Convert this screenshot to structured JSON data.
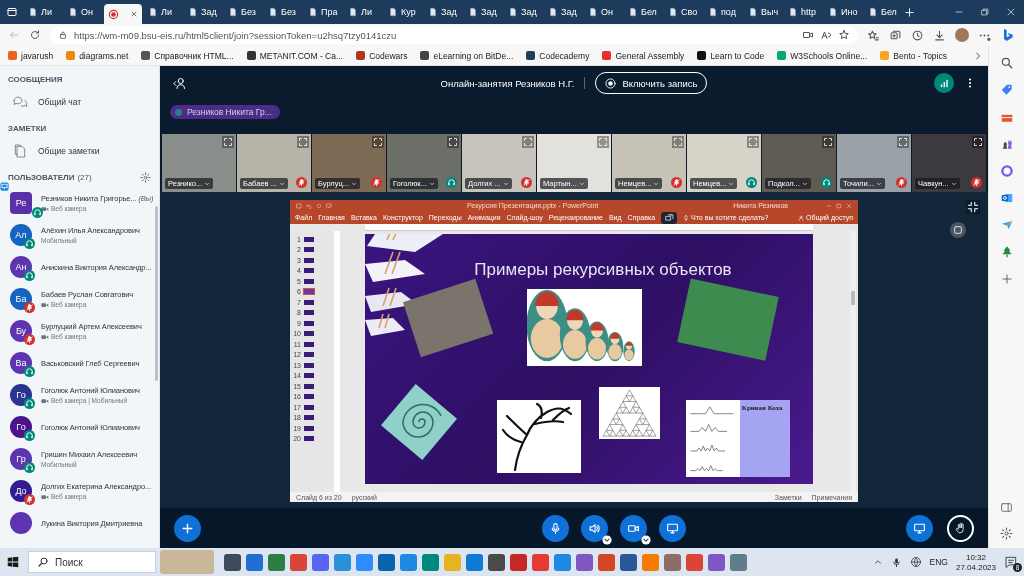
{
  "browser": {
    "tabs": [
      {
        "label": "Ли",
        "kind": "page",
        "selected": false
      },
      {
        "label": "Он",
        "kind": "page",
        "selected": false
      },
      {
        "kind": "record",
        "selected": true
      },
      {
        "label": "Ли",
        "kind": "page",
        "selected": false
      },
      {
        "label": "Зад",
        "kind": "page",
        "selected": false
      },
      {
        "label": "Без",
        "kind": "page",
        "selected": false
      },
      {
        "label": "Без",
        "kind": "page",
        "selected": false
      },
      {
        "label": "Пра",
        "kind": "page",
        "selected": false
      },
      {
        "label": "Ли",
        "kind": "page",
        "selected": false
      },
      {
        "label": "Кур",
        "kind": "page",
        "selected": false
      },
      {
        "label": "Зад",
        "kind": "page",
        "selected": false
      },
      {
        "label": "Зад",
        "kind": "page",
        "selected": false
      },
      {
        "label": "Зад",
        "kind": "page",
        "selected": false
      },
      {
        "label": "Зад",
        "kind": "page",
        "selected": false
      },
      {
        "label": "Он",
        "kind": "page",
        "selected": false
      },
      {
        "label": "Бел",
        "kind": "page",
        "selected": false
      },
      {
        "label": "Сво",
        "kind": "page",
        "selected": false
      },
      {
        "label": "под",
        "kind": "page",
        "selected": false
      },
      {
        "label": "Выч",
        "kind": "page",
        "selected": false
      },
      {
        "label": "http",
        "kind": "page",
        "selected": false
      },
      {
        "label": "Ино",
        "kind": "page",
        "selected": false
      },
      {
        "label": "Бел",
        "kind": "page",
        "selected": false
      }
    ],
    "address": "https://wm-m09.bsu-eis.ru/html5client/join?sessionToken=u2hsq7tzy0141czu",
    "bookmarks": [
      {
        "label": "javarush",
        "color": "#e8641b"
      },
      {
        "label": "diagrams.net",
        "color": "#f08705"
      },
      {
        "label": "Справочник HTML...",
        "color": "#555555"
      },
      {
        "label": "METANIT.COM - Са...",
        "color": "#333333"
      },
      {
        "label": "Codewars",
        "color": "#b1361e"
      },
      {
        "label": "eLearning on BitDe...",
        "color": "#444444"
      },
      {
        "label": "Codecademy",
        "color": "#1f4056"
      },
      {
        "label": "General Assembly",
        "color": "#e5302c"
      },
      {
        "label": "Learn to Code",
        "color": "#111111"
      },
      {
        "label": "W3Schools Online...",
        "color": "#04aa6d"
      },
      {
        "label": "Bento - Topics",
        "color": "#f6a623"
      }
    ]
  },
  "sidebar": {
    "messages_header": "СООБЩЕНИЯ",
    "chat": "Общий чат",
    "notes_header": "ЗАМЕТКИ",
    "notes": "Общие заметки",
    "users_header": "ПОЛЬЗОВАТЕЛИ",
    "users_count": "(27)",
    "users": [
      {
        "initials": "Ре",
        "name": "Резников Никита Григорье...",
        "you_label": "(Вы)",
        "moderator": true,
        "presenter": true,
        "subtitle": "Веб камера",
        "camera_icon": true,
        "muted": false,
        "listen_only": true,
        "color": "#5b2fa8"
      },
      {
        "initials": "Ал",
        "name": "Алёхин Илья Александрович",
        "moderator": false,
        "presenter": false,
        "subtitle": "Мобильный",
        "camera_icon": false,
        "muted": false,
        "listen_only": true,
        "color": "#1565c0"
      },
      {
        "initials": "Ан",
        "name": "Анискина Виктория Александр...",
        "moderator": false,
        "presenter": false,
        "muted": false,
        "listen_only": true,
        "color": "#5e35b1"
      },
      {
        "initials": "Ба",
        "name": "Бабаев Руслан Совгатович",
        "moderator": false,
        "presenter": false,
        "subtitle": "Веб камера",
        "camera_icon": true,
        "muted": true,
        "listen_only": false,
        "color": "#1565c0"
      },
      {
        "initials": "Бу",
        "name": "Бурлуцкий Артем Алексеевич",
        "moderator": false,
        "presenter": false,
        "subtitle": "Веб камера",
        "camera_icon": true,
        "muted": true,
        "listen_only": false,
        "color": "#5e35b1"
      },
      {
        "initials": "Ва",
        "name": "Васьковский Глеб Сергеевич",
        "moderator": false,
        "presenter": false,
        "muted": false,
        "listen_only": true,
        "color": "#5e35b1"
      },
      {
        "initials": "Го",
        "name": "Гоголюк Антоний Юлианович",
        "moderator": false,
        "presenter": false,
        "subtitle": "Веб камера | Мобильный",
        "camera_icon": true,
        "muted": false,
        "listen_only": true,
        "color": "#283593"
      },
      {
        "initials": "Го",
        "name": "Гоголюк Антоний Юлианович",
        "moderator": false,
        "presenter": false,
        "muted": false,
        "listen_only": true,
        "color": "#4a148c"
      },
      {
        "initials": "Гр",
        "name": "Гришин Михаил Алексеевич",
        "moderator": false,
        "presenter": false,
        "subtitle": "Мобильный",
        "camera_icon": false,
        "muted": false,
        "listen_only": true,
        "color": "#5e35b1"
      },
      {
        "initials": "До",
        "name": "Долгих Екатерина Александро...",
        "moderator": false,
        "presenter": false,
        "subtitle": "Веб камера",
        "camera_icon": true,
        "muted": true,
        "listen_only": false,
        "color": "#311b92"
      },
      {
        "name": "Лукина Виктория Дмитриевна",
        "moderator": false,
        "presenter": false,
        "muted": false,
        "listen_only": false,
        "color": "#5e35b1"
      }
    ]
  },
  "meeting": {
    "title": "Онлайн-занятия Резников Н.Г.",
    "record_button": "Включить запись",
    "talking": "Резников Никита Гр...",
    "videos": [
      {
        "name": "Резнико...",
        "muted": false,
        "listen_only": false
      },
      {
        "name": "Бабаев ...",
        "muted": true,
        "listen_only": false
      },
      {
        "name": "Бурлуц...",
        "muted": true,
        "listen_only": false
      },
      {
        "name": "Гоголюк...",
        "muted": false,
        "listen_only": true
      },
      {
        "name": "Долгих ...",
        "muted": true,
        "listen_only": false
      },
      {
        "name": "Мартын...",
        "muted": false,
        "listen_only": false
      },
      {
        "name": "Немцев...",
        "muted": true,
        "listen_only": false
      },
      {
        "name": "Немцев...",
        "muted": false,
        "listen_only": true
      },
      {
        "name": "Подкол...",
        "muted": false,
        "listen_only": true
      },
      {
        "name": "Точили...",
        "muted": true,
        "listen_only": false
      },
      {
        "name": "Чавкун...",
        "muted": true,
        "listen_only": false
      }
    ]
  },
  "presentation": {
    "app_title": "Рекурсия Презентация.pptx - PowerPoint",
    "user": "Никита Резников",
    "ribbon_tabs": [
      "Файл",
      "Главная",
      "Вставка",
      "Конструктор",
      "Переходы",
      "Анимация",
      "Слайд-шоу",
      "Рецензирование",
      "Вид",
      "Справка"
    ],
    "tell_me": "Что вы хотите сделать?",
    "share": "Общий доступ",
    "thumbnails": [
      {
        "number": "1",
        "selected": false
      },
      {
        "number": "2",
        "selected": false
      },
      {
        "number": "3",
        "selected": false
      },
      {
        "number": "4",
        "selected": false
      },
      {
        "number": "5",
        "selected": false
      },
      {
        "number": "6",
        "selected": true
      },
      {
        "number": "7",
        "selected": false
      },
      {
        "number": "8",
        "selected": false
      },
      {
        "number": "9",
        "selected": false
      },
      {
        "number": "10",
        "selected": false
      },
      {
        "number": "11",
        "selected": false
      },
      {
        "number": "12",
        "selected": false
      },
      {
        "number": "13",
        "selected": false
      },
      {
        "number": "14",
        "selected": false
      },
      {
        "number": "15",
        "selected": false
      },
      {
        "number": "16",
        "selected": false
      },
      {
        "number": "17",
        "selected": false
      },
      {
        "number": "18",
        "selected": false
      },
      {
        "number": "19",
        "selected": false
      },
      {
        "number": "20",
        "selected": false
      }
    ],
    "slide_title": "Примеры рекурсивных объектов",
    "koch_caption": "Кривая Коха",
    "status_left": [
      "Слайд 6 из 20",
      "русский"
    ],
    "status_right": [
      "Заметки",
      "Примечания"
    ]
  },
  "taskbar": {
    "search_placeholder": "Поиск",
    "language": "ENG",
    "time": "10:32",
    "date": "27.04.2023",
    "notifications": "8"
  }
}
